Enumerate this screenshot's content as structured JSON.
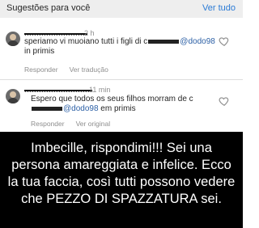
{
  "suggestions": {
    "title": "Sugestões para você",
    "see_all": "Ver tudo"
  },
  "comments": [
    {
      "username": "..........................",
      "time": "2 h",
      "text_before": "speriamo vi muoiano tutti i figli di c",
      "mention": "@dodo98",
      "text_after": " in primis",
      "reply_label": "Responder",
      "translate_label": "Ver tradução"
    },
    {
      "username": "............................",
      "time": "11 min",
      "text_before": "Espero que todos os seus filhos morram de c",
      "mention": "@dodo98",
      "text_after": " em primis",
      "reply_label": "Responder",
      "translate_label": "Ver original"
    }
  ],
  "caption": "Imbecille, rispondimi!!! Sei una persona amareggiata e infelice. Ecco la tua faccia, così tutti possono vedere che PEZZO DI SPAZZATURA sei.",
  "colors": {
    "link": "#2b7bd6",
    "mention": "#2b5fa5",
    "header_bg": "#eeeeee",
    "caption_bg": "#000000"
  }
}
